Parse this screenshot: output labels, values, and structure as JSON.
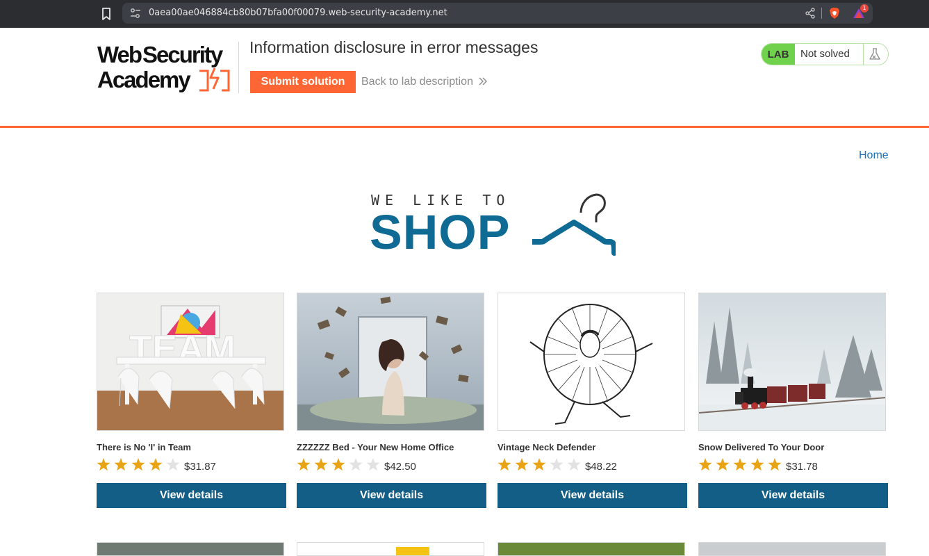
{
  "browser": {
    "url": "0aea00ae046884cb80b07bfa00f00079.web-security-academy.net",
    "rewards_badge": "1"
  },
  "lab": {
    "logo_text": "WebSecurity Academy",
    "title": "Information disclosure in error messages",
    "submit_label": "Submit solution",
    "back_label": "Back to lab description",
    "badge": "LAB",
    "status": "Not solved"
  },
  "nav": {
    "home_label": "Home"
  },
  "banner": {
    "tagline": "WE LIKE TO",
    "word": "SHOP"
  },
  "products": [
    {
      "name": "There is No 'I' in Team",
      "price": "$31.87",
      "rating": 4,
      "button": "View details"
    },
    {
      "name": "ZZZZZZ Bed - Your New Home Office",
      "price": "$42.50",
      "rating": 3,
      "button": "View details"
    },
    {
      "name": "Vintage Neck Defender",
      "price": "$48.22",
      "rating": 3,
      "button": "View details"
    },
    {
      "name": "Snow Delivered To Your Door",
      "price": "$31.78",
      "rating": 5,
      "button": "View details"
    }
  ],
  "colors": {
    "orange": "#ff6633",
    "button_blue": "#125e86",
    "banner_blue": "#0f6b94",
    "lab_green": "#70d14d",
    "star_on": "#e8a415",
    "star_off": "#e2e2e2"
  }
}
